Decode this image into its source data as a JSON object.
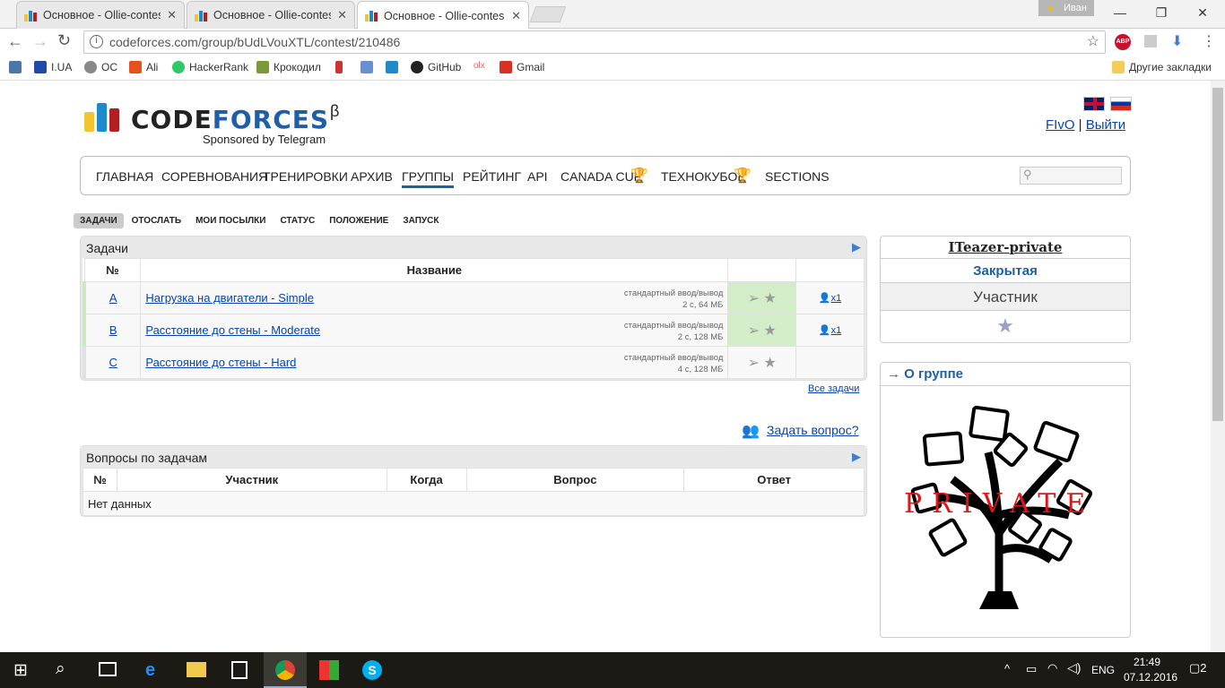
{
  "browser": {
    "tabs": [
      {
        "title": "Основное - Ollie-contes"
      },
      {
        "title": "Основное - Ollie-contes"
      },
      {
        "title": "Основное - Ollie-contes"
      }
    ],
    "user": "Иван",
    "url": "codeforces.com/group/bUdLVouXTL/contest/210486",
    "bookmarks": [
      "I.UA",
      "OC",
      "Ali",
      "HackerRank",
      "Крокодил",
      "GitHub",
      "Gmail"
    ],
    "other_bookmarks": "Другие закладки"
  },
  "site": {
    "logo_code": "CODE",
    "logo_forces": "FORCES",
    "logo_beta": "β",
    "sponsor": "Sponsored by Telegram",
    "user_link": "FIvO",
    "separator": "|",
    "logout": "Выйти",
    "menu": [
      "ГЛАВНАЯ",
      "СОРЕВНОВАНИЯ",
      "ТРЕНИРОВКИ",
      "АРХИВ",
      "ГРУППЫ",
      "РЕЙТИНГ",
      "API",
      "CANADA CUP",
      "ТЕХНОКУБОК",
      "SECTIONS"
    ],
    "active_menu": "ГРУППЫ"
  },
  "submenu": [
    "ЗАДАЧИ",
    "ОТОСЛАТЬ",
    "МОИ ПОСЫЛКИ",
    "СТАТУС",
    "ПОЛОЖЕНИЕ",
    "ЗАПУСК"
  ],
  "problems": {
    "title": "Задачи",
    "col_num": "№",
    "col_name": "Название",
    "rows": [
      {
        "id": "A",
        "name": "Нагрузка на двигатели - Simple",
        "io": "стандартный ввод/вывод",
        "limits": "2 с, 64 МБ",
        "solved": "x1"
      },
      {
        "id": "B",
        "name": "Расстояние до стены - Moderate",
        "io": "стандартный ввод/вывод",
        "limits": "2 с, 128 МБ",
        "solved": "x1"
      },
      {
        "id": "C",
        "name": "Расстояние до стены - Hard",
        "io": "стандартный ввод/вывод",
        "limits": "4 с, 128 МБ",
        "solved": ""
      }
    ],
    "all": "Все задачи"
  },
  "ask": "Задать вопрос?",
  "questions": {
    "title": "Вопросы по задачам",
    "cols": [
      "№",
      "Участник",
      "Когда",
      "Вопрос",
      "Ответ"
    ],
    "empty": "Нет данных"
  },
  "sidebar": {
    "contest": "ITeazer-private",
    "type": "Закрытая",
    "role": "Участник",
    "about": "→ О группе",
    "private": "PRIVATE"
  },
  "taskbar": {
    "lang": "ENG",
    "time": "21:49",
    "date": "07.12.2016",
    "notif": "2"
  }
}
